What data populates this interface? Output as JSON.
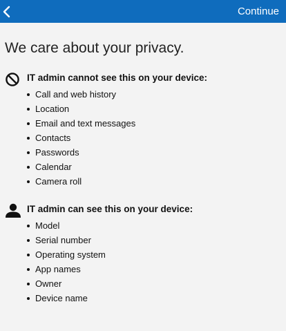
{
  "header": {
    "back_icon": "chevron-left-icon",
    "continue_label": "Continue",
    "accent_color": "#0f6cbd"
  },
  "main": {
    "title": "We care about your privacy.",
    "cannot_see": {
      "icon": "prohibited-icon",
      "heading": "IT admin cannot see this on your device:",
      "items": [
        "Call and web history",
        "Location",
        "Email and text messages",
        "Contacts",
        "Passwords",
        "Calendar",
        "Camera roll"
      ]
    },
    "can_see": {
      "icon": "person-icon",
      "heading": "IT admin can see this on your device:",
      "items": [
        "Model",
        "Serial number",
        "Operating system",
        "App names",
        "Owner",
        "Device name"
      ]
    }
  }
}
